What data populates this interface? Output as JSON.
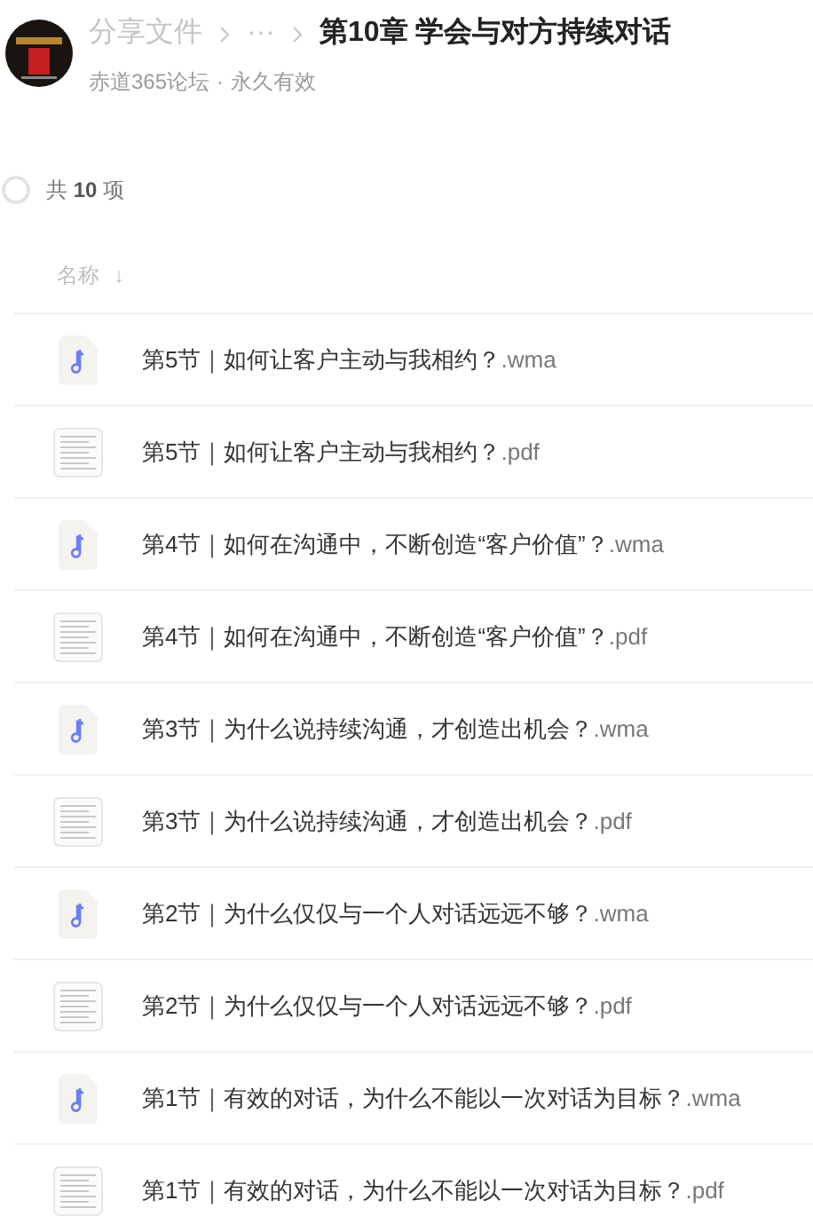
{
  "header": {
    "breadcrumbs": [
      "分享文件",
      "···"
    ],
    "title": "第10章 学会与对方持续对话",
    "owner": "赤道365论坛",
    "separator": "·",
    "validity": "永久有效"
  },
  "summary": {
    "checked": false,
    "prefix": "共",
    "count": "10",
    "suffix": "项"
  },
  "columns": [
    {
      "label": "名称",
      "sort_icon": "↓"
    }
  ],
  "files": [
    {
      "kind": "audio",
      "name": "第5节｜如何让客户主动与我相约？",
      "ext": ".wma"
    },
    {
      "kind": "pdf",
      "name": "第5节｜如何让客户主动与我相约？",
      "ext": ".pdf"
    },
    {
      "kind": "audio",
      "name": "第4节｜如何在沟通中，不断创造“客户价值”？",
      "ext": ".wma"
    },
    {
      "kind": "pdf",
      "name": "第4节｜如何在沟通中，不断创造“客户价值”？",
      "ext": ".pdf"
    },
    {
      "kind": "audio",
      "name": "第3节｜为什么说持续沟通，才创造出机会？",
      "ext": ".wma"
    },
    {
      "kind": "pdf",
      "name": "第3节｜为什么说持续沟通，才创造出机会？",
      "ext": ".pdf"
    },
    {
      "kind": "audio",
      "name": "第2节｜为什么仅仅与一个人对话远远不够？",
      "ext": ".wma"
    },
    {
      "kind": "pdf",
      "name": "第2节｜为什么仅仅与一个人对话远远不够？",
      "ext": ".pdf"
    },
    {
      "kind": "audio",
      "name": "第1节｜有效的对话，为什么不能以一次对话为目标？",
      "ext": ".wma"
    },
    {
      "kind": "pdf",
      "name": "第1节｜有效的对话，为什么不能以一次对话为目标？",
      "ext": ".pdf"
    }
  ]
}
